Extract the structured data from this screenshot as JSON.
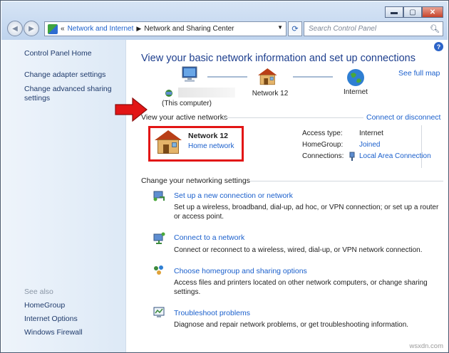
{
  "window": {
    "minimize": "▬",
    "maximize": "▢",
    "close": "✕"
  },
  "nav": {
    "back_glyph": "◀",
    "forward_glyph": "▶",
    "address_prefix": "«",
    "crumbs": [
      "Network and Internet",
      "Network and Sharing Center"
    ],
    "crumb_sep": "▶",
    "dropdown_glyph": "▼",
    "refresh_glyph": "⟳",
    "search_placeholder": "Search Control Panel"
  },
  "left_pane": {
    "home": "Control Panel Home",
    "links": [
      "Change adapter settings",
      "Change advanced sharing settings"
    ],
    "see_also_label": "See also",
    "see_also": [
      "HomeGroup",
      "Internet Options",
      "Windows Firewall"
    ]
  },
  "main": {
    "help": "?",
    "heading": "View your basic network information and set up connections",
    "full_map": "See full map",
    "map": {
      "computer_label": "(This computer)",
      "network_label": "Network 12",
      "internet_label": "Internet"
    },
    "active_label": "View your active networks",
    "connect_disconnect": "Connect or disconnect",
    "network": {
      "name": "Network  12",
      "type": "Home network"
    },
    "details": {
      "access_type_label": "Access type:",
      "access_type": "Internet",
      "homegroup_label": "HomeGroup:",
      "homegroup": "Joined",
      "connections_label": "Connections:",
      "connection": "Local Area Connection"
    },
    "change_label": "Change your networking settings",
    "tasks": [
      {
        "title": "Set up a new connection or network",
        "desc": "Set up a wireless, broadband, dial-up, ad hoc, or VPN connection; or set up a router or access point."
      },
      {
        "title": "Connect to a network",
        "desc": "Connect or reconnect to a wireless, wired, dial-up, or VPN network connection."
      },
      {
        "title": "Choose homegroup and sharing options",
        "desc": "Access files and printers located on other network computers, or change sharing settings."
      },
      {
        "title": "Troubleshoot problems",
        "desc": "Diagnose and repair network problems, or get troubleshooting information."
      }
    ]
  },
  "colors": {
    "accent_link": "#1a5fcc",
    "heading": "#1e3f8e",
    "highlight": "#e21515"
  },
  "watermark": "wsxdn.com"
}
